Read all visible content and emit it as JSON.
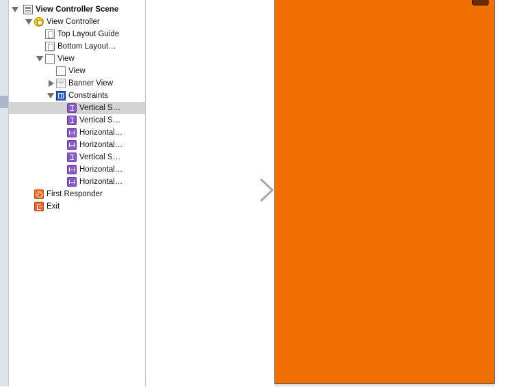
{
  "outline": {
    "rows": [
      {
        "label": "View Controller Scene",
        "icon": "scene-icon",
        "depth": 0,
        "disclosure": "expanded",
        "bold": true
      },
      {
        "label": "View Controller",
        "icon": "view-controller-icon",
        "depth": 1,
        "disclosure": "expanded"
      },
      {
        "label": "Top Layout Guide",
        "icon": "layout-guide-icon",
        "depth": 2,
        "disclosure": "none"
      },
      {
        "label": "Bottom Layout…",
        "icon": "layout-guide-icon",
        "depth": 2,
        "disclosure": "none"
      },
      {
        "label": "View",
        "icon": "view-icon",
        "depth": 2,
        "disclosure": "expanded"
      },
      {
        "label": "View",
        "icon": "view-icon",
        "depth": 3,
        "disclosure": "none"
      },
      {
        "label": "Banner View",
        "icon": "banner-view-icon",
        "depth": 3,
        "disclosure": "collapsed"
      },
      {
        "label": "Constraints",
        "icon": "constraints-icon",
        "depth": 3,
        "disclosure": "expanded"
      },
      {
        "label": "Vertical S…",
        "icon": "vertical-constraint-icon",
        "depth": 4,
        "disclosure": "none",
        "selected": true
      },
      {
        "label": "Vertical S…",
        "icon": "vertical-constraint-icon",
        "depth": 4,
        "disclosure": "none"
      },
      {
        "label": "Horizontal…",
        "icon": "horizontal-constraint-icon",
        "depth": 4,
        "disclosure": "none"
      },
      {
        "label": "Horizontal…",
        "icon": "horizontal-constraint-icon",
        "depth": 4,
        "disclosure": "none"
      },
      {
        "label": "Vertical S…",
        "icon": "vertical-constraint-icon",
        "depth": 4,
        "disclosure": "none"
      },
      {
        "label": "Horizontal…",
        "icon": "horizontal-constraint-icon",
        "depth": 4,
        "disclosure": "none"
      },
      {
        "label": "Horizontal…",
        "icon": "horizontal-constraint-icon",
        "depth": 4,
        "disclosure": "none"
      },
      {
        "label": "First Responder",
        "icon": "first-responder-icon",
        "depth": 1,
        "disclosure": "none"
      },
      {
        "label": "Exit",
        "icon": "exit-icon",
        "depth": 1,
        "disclosure": "none"
      }
    ]
  },
  "canvas": {
    "entry_point_arrow": "storyboard-entry-arrow-icon",
    "view_background_color": "#f06f00",
    "selection_color": "#d4d4d4"
  }
}
